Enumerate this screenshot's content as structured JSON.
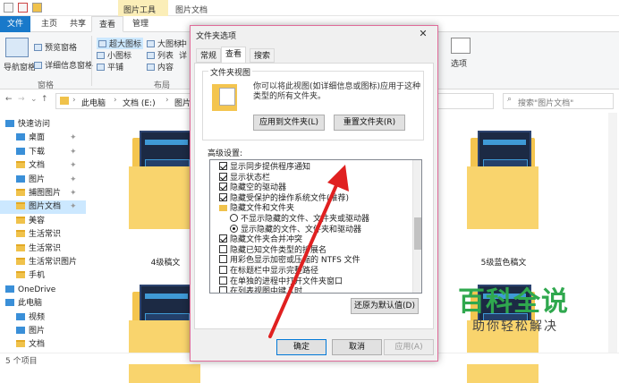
{
  "window": {
    "title": "图片文档",
    "context_tab": "图片工具"
  },
  "ribbon": {
    "tabs": [
      "文件",
      "主页",
      "共享",
      "查看",
      "管理"
    ],
    "nav_pane_label": "导航窗格",
    "preview_pane": "预览窗格",
    "details_pane": "详细信息窗格",
    "layout_items": [
      "超大图标",
      "大图标",
      "中",
      "小图标",
      "列表",
      "详",
      "平铺",
      "内容"
    ],
    "options_label": "选项",
    "group_panes": "窗格",
    "group_layout": "布局"
  },
  "address": {
    "path": [
      "此电脑",
      "文档 (E:)",
      "图片文档"
    ],
    "search_placeholder": "搜索\"图片文档\""
  },
  "nav": {
    "items": [
      {
        "label": "快速访问",
        "type": "star",
        "pinned": false
      },
      {
        "label": "桌面",
        "type": "blue",
        "pinned": true
      },
      {
        "label": "下载",
        "type": "blue",
        "pinned": true
      },
      {
        "label": "文档",
        "type": "folder",
        "pinned": true
      },
      {
        "label": "图片",
        "type": "blue",
        "pinned": true
      },
      {
        "label": "捕图图片",
        "type": "folder",
        "pinned": true
      },
      {
        "label": "图片文档",
        "type": "folder",
        "pinned": true,
        "selected": true
      },
      {
        "label": "美容",
        "type": "folder",
        "pinned": false
      },
      {
        "label": "生活常识",
        "type": "folder",
        "pinned": false
      },
      {
        "label": "生活常识",
        "type": "folder",
        "pinned": false
      },
      {
        "label": "生活常识图片",
        "type": "folder",
        "pinned": false
      },
      {
        "label": "手机",
        "type": "folder",
        "pinned": false
      },
      {
        "label": "OneDrive",
        "type": "blue",
        "pinned": false
      },
      {
        "label": "此电脑",
        "type": "blue",
        "pinned": false
      },
      {
        "label": "视频",
        "type": "blue",
        "pinned": false
      },
      {
        "label": "图片",
        "type": "blue",
        "pinned": false
      },
      {
        "label": "文档",
        "type": "folder",
        "pinned": false
      }
    ]
  },
  "content": {
    "files": [
      "4级稿文",
      "5级蓝色稿文"
    ]
  },
  "status": {
    "count": "5 个项目"
  },
  "dialog": {
    "title": "文件夹选项",
    "tabs": [
      "常规",
      "查看",
      "搜索"
    ],
    "folder_views_legend": "文件夹视图",
    "folder_views_desc": "你可以将此视图(如详细信息或图标)应用于这种类型的所有文件夹。",
    "apply_to_folders": "应用到文件夹(L)",
    "reset_folders": "重置文件夹(R)",
    "advanced_label": "高级设置:",
    "advanced_items": [
      {
        "kind": "check",
        "checked": true,
        "indent": 0,
        "label": "显示同步提供程序通知"
      },
      {
        "kind": "check",
        "checked": true,
        "indent": 0,
        "label": "显示状态栏"
      },
      {
        "kind": "check",
        "checked": true,
        "indent": 0,
        "label": "隐藏空的驱动器"
      },
      {
        "kind": "check",
        "checked": true,
        "indent": 0,
        "label": "隐藏受保护的操作系统文件(推荐)"
      },
      {
        "kind": "folder",
        "checked": false,
        "indent": 0,
        "label": "隐藏文件和文件夹"
      },
      {
        "kind": "radio",
        "checked": false,
        "indent": 1,
        "label": "不显示隐藏的文件、文件夹或驱动器"
      },
      {
        "kind": "radio",
        "checked": true,
        "indent": 1,
        "label": "显示隐藏的文件、文件夹和驱动器"
      },
      {
        "kind": "check",
        "checked": true,
        "indent": 0,
        "label": "隐藏文件夹合并冲突"
      },
      {
        "kind": "check",
        "checked": false,
        "indent": 0,
        "label": "隐藏已知文件类型的扩展名"
      },
      {
        "kind": "check",
        "checked": false,
        "indent": 0,
        "label": "用彩色显示加密或压缩的 NTFS 文件"
      },
      {
        "kind": "check",
        "checked": false,
        "indent": 0,
        "label": "在标题栏中显示完整路径"
      },
      {
        "kind": "check",
        "checked": false,
        "indent": 0,
        "label": "在单独的进程中打开文件夹窗口"
      },
      {
        "kind": "check",
        "checked": false,
        "indent": 0,
        "label": "在列表视图中键入时"
      }
    ],
    "restore_defaults": "还原为默认值(D)",
    "ok": "确定",
    "cancel": "取消",
    "apply": "应用(A)"
  },
  "watermark": {
    "line1": "百科全说",
    "line2": "助你轻松解决"
  },
  "colors": {
    "file_tab": "#1979ca",
    "context_tab": "#fbeeb8",
    "dialog_border": "#e06b9a",
    "arrow": "#e02020",
    "watermark": "#2fa84e"
  }
}
